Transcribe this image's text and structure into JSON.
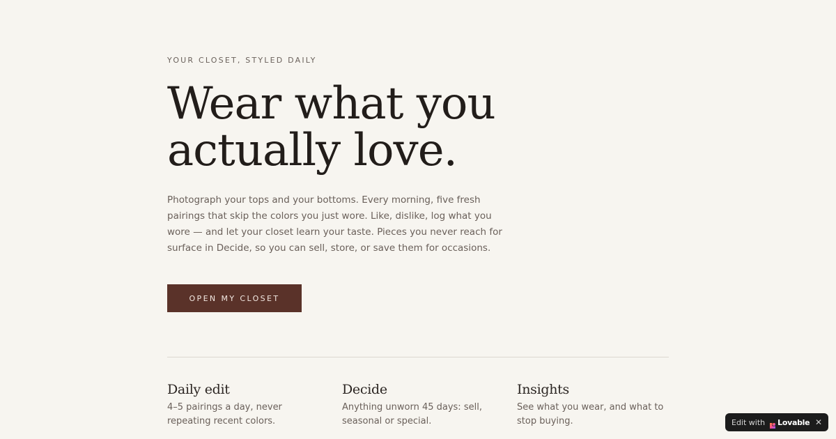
{
  "hero": {
    "eyebrow": "YOUR CLOSET, STYLED DAILY",
    "headline_line1": "Wear what you",
    "headline_line2": "actually love.",
    "lead": "Photograph your tops and your bottoms. Every morning, five fresh pairings that skip the colors you just wore. Like, dislike, log what you wore — and let your closet learn your taste. Pieces you never reach for surface in Decide, so you can sell, store, or save them for occasions.",
    "cta_label": "OPEN MY CLOSET"
  },
  "features": [
    {
      "title": "Daily edit",
      "description": "4–5 pairings a day, never repeating recent colors."
    },
    {
      "title": "Decide",
      "description": "Anything unworn 45 days: sell, seasonal or special."
    },
    {
      "title": "Insights",
      "description": "See what you wear, and what to stop buying."
    }
  ],
  "badge": {
    "prefix": "Edit with",
    "brand": "Lovable",
    "close": "✕",
    "icon": "lovable-heart-icon"
  },
  "colors": {
    "background": "#f7f5f0",
    "cta_background": "#5a3229",
    "cta_text": "#f3e9e3",
    "heading": "#221d1a",
    "body_text": "#6a605a",
    "divider": "#dcd7d0",
    "badge_background": "#1c1c1c"
  }
}
